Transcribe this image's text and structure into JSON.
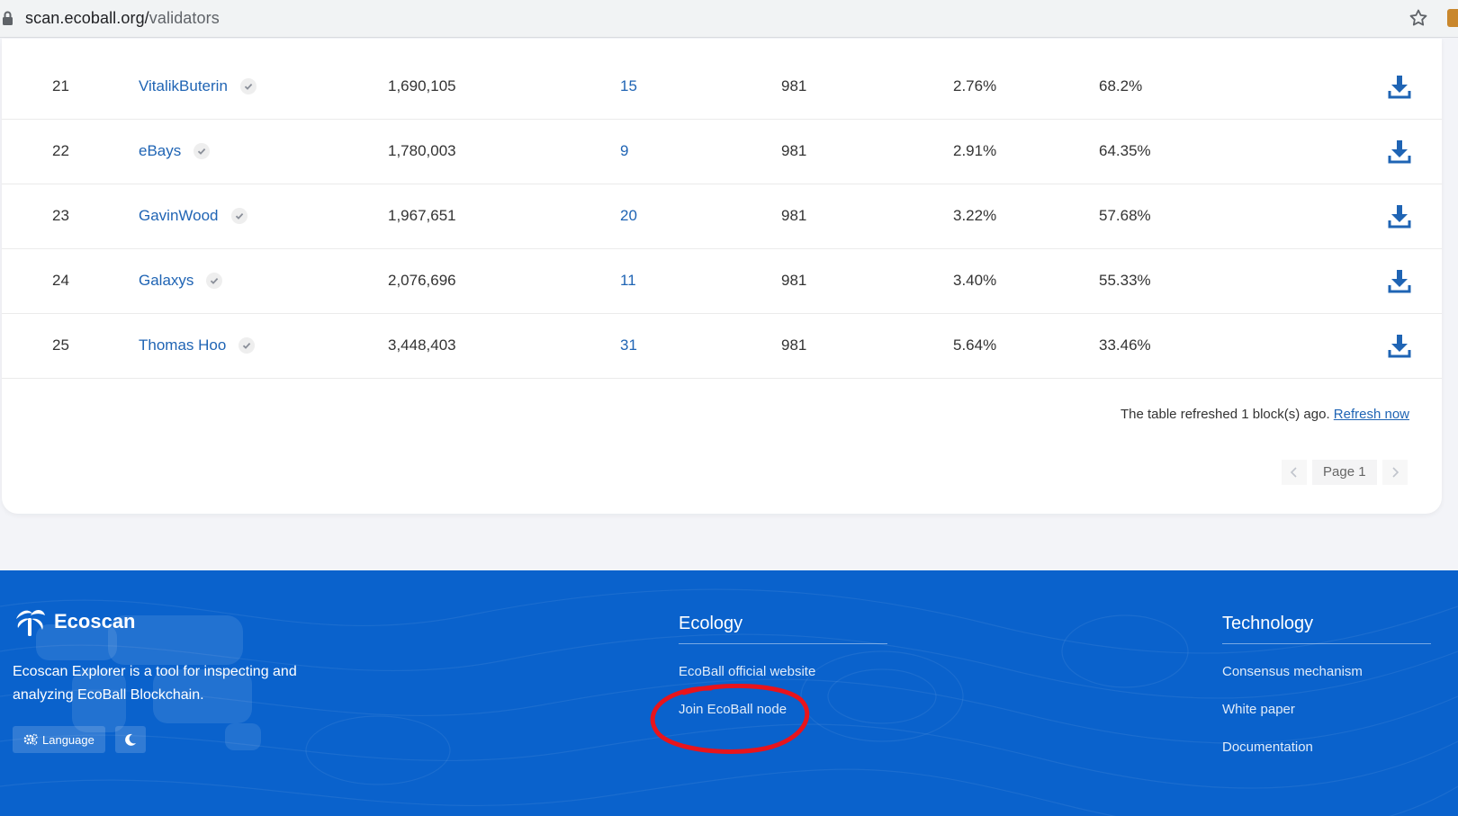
{
  "browser": {
    "url_host": "scan.ecoball.org/",
    "url_path": "validators"
  },
  "table": {
    "rows": [
      {
        "rank": "21",
        "name": "VitalikButerin",
        "stake": "1,690,105",
        "votes": "15",
        "blocks": "981",
        "ratio": "2.76%",
        "miss": "68.2%"
      },
      {
        "rank": "22",
        "name": "eBays",
        "stake": "1,780,003",
        "votes": "9",
        "blocks": "981",
        "ratio": "2.91%",
        "miss": "64.35%"
      },
      {
        "rank": "23",
        "name": "GavinWood",
        "stake": "1,967,651",
        "votes": "20",
        "blocks": "981",
        "ratio": "3.22%",
        "miss": "57.68%"
      },
      {
        "rank": "24",
        "name": "Galaxys",
        "stake": "2,076,696",
        "votes": "11",
        "blocks": "981",
        "ratio": "3.40%",
        "miss": "55.33%"
      },
      {
        "rank": "25",
        "name": "Thomas Hoo",
        "stake": "3,448,403",
        "votes": "31",
        "blocks": "981",
        "ratio": "5.64%",
        "miss": "33.46%"
      }
    ],
    "refresh_text": "The table refreshed 1 block(s) ago.",
    "refresh_link": "Refresh now",
    "page_label": "Page 1"
  },
  "footer": {
    "brand": "Ecoscan",
    "description": "Ecoscan Explorer is a tool for inspecting and analyzing EcoBall Blockchain.",
    "language_label": "Language",
    "ecology": {
      "heading": "Ecology",
      "links": [
        "EcoBall official website",
        "Join EcoBall node"
      ]
    },
    "technology": {
      "heading": "Technology",
      "links": [
        "Consensus mechanism",
        "White paper",
        "Documentation"
      ]
    }
  },
  "colors": {
    "link_blue": "#1f64b4",
    "footer_blue": "#0a62cc",
    "annotation_red": "#e8141c"
  },
  "icons": {
    "lock": "lock-icon",
    "star": "bookmark-star-icon",
    "verified": "check-icon",
    "download": "download-icon",
    "language": "gear-icon",
    "dark_mode": "moon-icon"
  }
}
